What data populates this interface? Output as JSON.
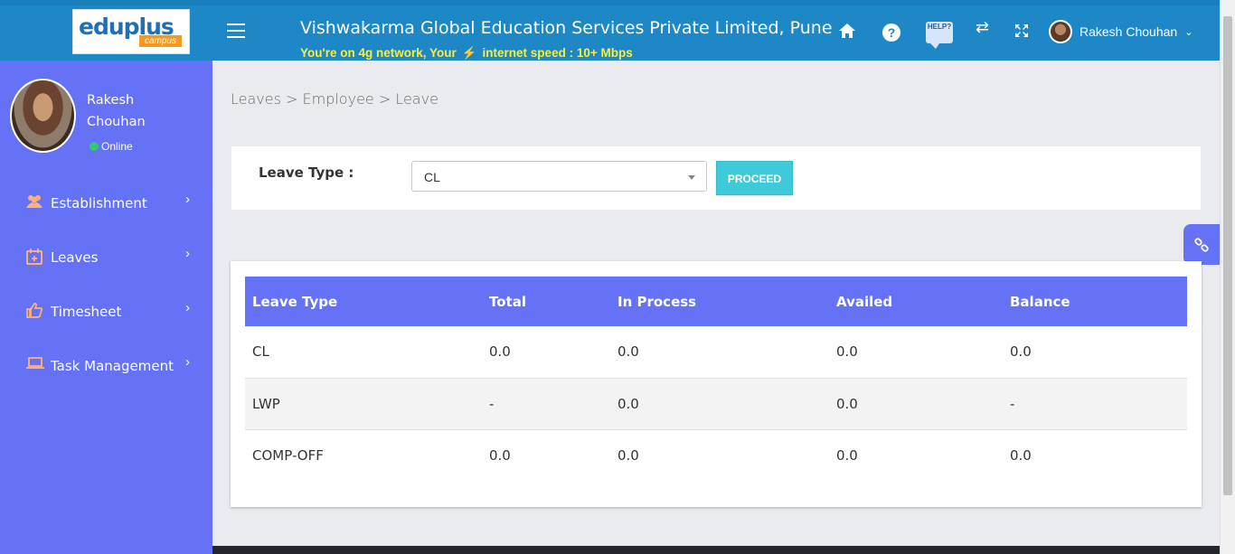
{
  "header": {
    "logo_text": "eduplus",
    "logo_sub": "campus",
    "org_title": "Vishwakarma Global Education Services Private Limited, Pune",
    "network_prefix": "You're on 4g network, Your",
    "network_suffix": "internet speed : 10+ Mbps",
    "help_bubble_text": "HELP?",
    "user_name": "Rakesh Chouhan",
    "icons": [
      "home-icon",
      "question-icon",
      "help-bubble-icon",
      "swap-icon",
      "fullscreen-icon",
      "chevron-down-icon"
    ]
  },
  "sidebar": {
    "profile_name": "Rakesh Chouhan",
    "status": "Online",
    "items": [
      {
        "label": "Establishment",
        "icon": "users-icon"
      },
      {
        "label": "Leaves",
        "icon": "calendar-plus-icon"
      },
      {
        "label": "Timesheet",
        "icon": "thumbs-up-icon"
      },
      {
        "label": "Task Management",
        "icon": "laptop-icon"
      }
    ]
  },
  "breadcrumb": "Leaves > Employee > Leave",
  "filter": {
    "label": "Leave Type :",
    "selected": "CL",
    "button": "PROCEED"
  },
  "table": {
    "columns": [
      "Leave Type",
      "Total",
      "In Process",
      "Availed",
      "Balance"
    ],
    "rows": [
      [
        "CL",
        "0.0",
        "0.0",
        "0.0",
        "0.0"
      ],
      [
        "LWP",
        "-",
        "0.0",
        "0.0",
        "-"
      ],
      [
        "COMP-OFF",
        "0.0",
        "0.0",
        "0.0",
        "0.0"
      ]
    ]
  },
  "colors": {
    "header_bg": "#1e88c7",
    "sidebar_bg": "#6572f6",
    "accent_button": "#3ecad9",
    "network_text": "#f6ef3e"
  }
}
